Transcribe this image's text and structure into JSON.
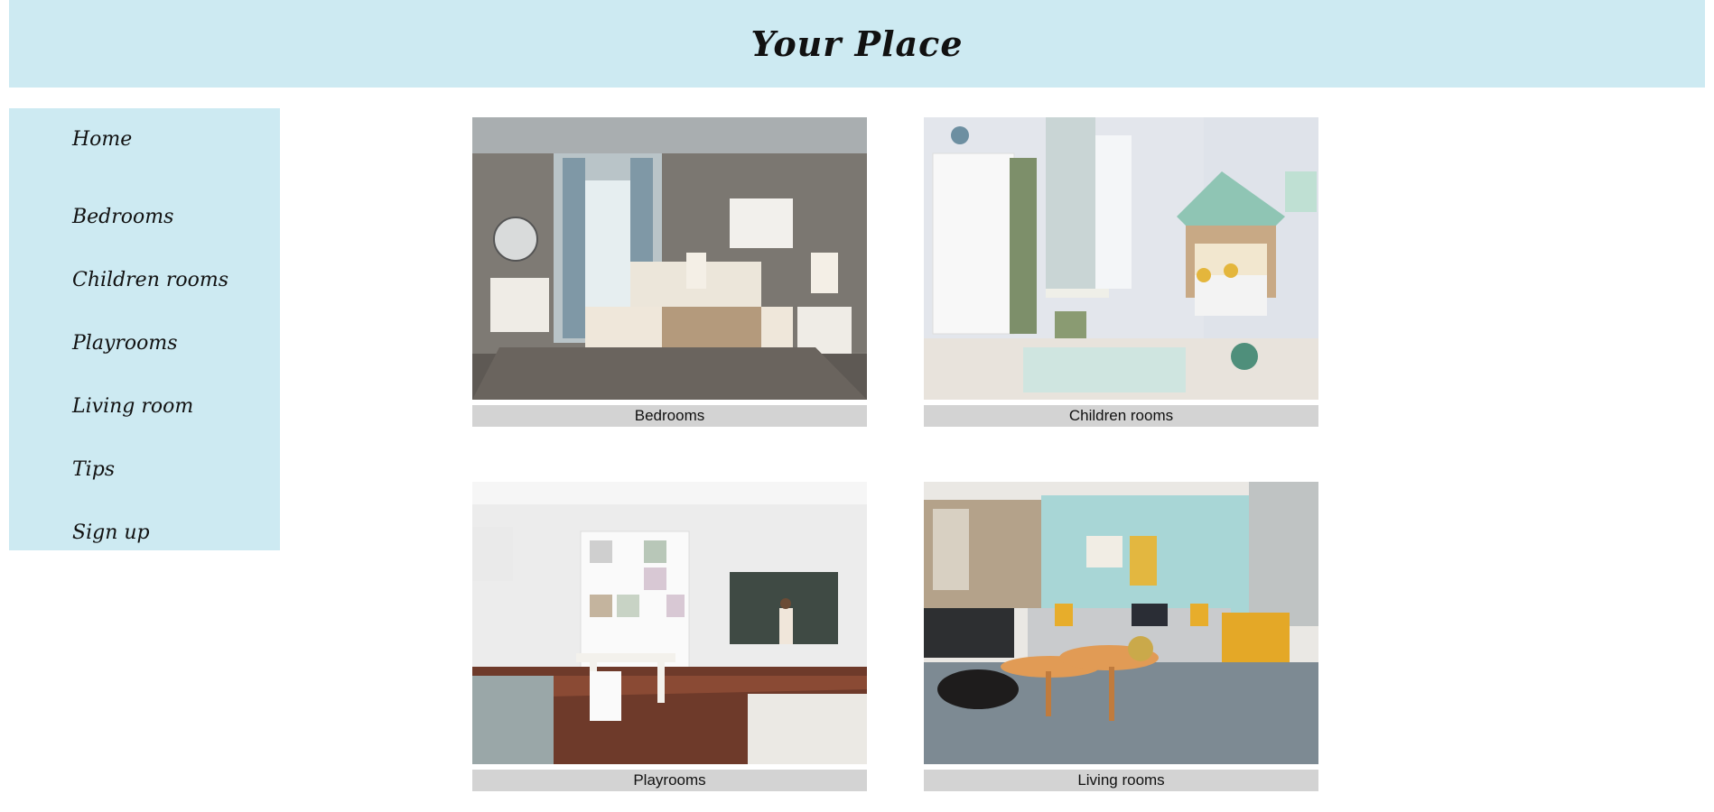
{
  "header": {
    "title": "Your Place"
  },
  "sidebar": {
    "items": [
      {
        "label": "Home"
      },
      {
        "label": "Bedrooms"
      },
      {
        "label": "Children rooms"
      },
      {
        "label": "Playrooms"
      },
      {
        "label": "Living room"
      },
      {
        "label": "Tips"
      },
      {
        "label": "Sign up"
      }
    ]
  },
  "gallery": {
    "cards": [
      {
        "caption": "Bedrooms"
      },
      {
        "caption": "Children rooms"
      },
      {
        "caption": "Playrooms"
      },
      {
        "caption": "Living rooms"
      }
    ]
  },
  "colors": {
    "panel_bg": "#cdeaf2",
    "caption_bg": "#d3d3d3"
  }
}
